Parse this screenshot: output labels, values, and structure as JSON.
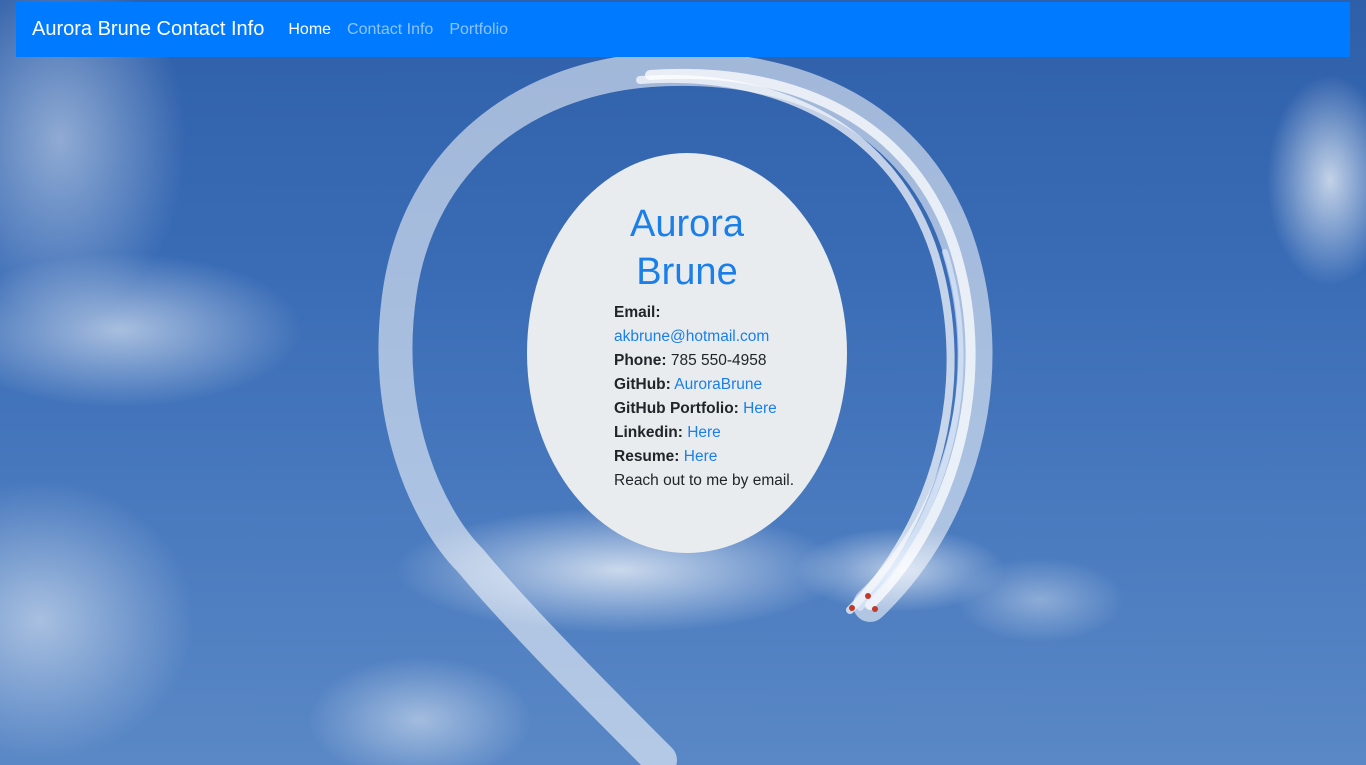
{
  "navbar": {
    "brand": "Aurora Brune Contact Info",
    "links": [
      {
        "label": "Home",
        "active": true
      },
      {
        "label": "Contact Info",
        "active": false
      },
      {
        "label": "Portfolio",
        "active": false
      }
    ]
  },
  "card": {
    "name_line1": "Aurora",
    "name_line2": "Brune",
    "email_label": "Email:",
    "email_value": "akbrune@hotmail.com",
    "phone_label": "Phone:",
    "phone_value": "785 550-4958",
    "github_label": "GitHub:",
    "github_value": "AuroraBrune",
    "github_portfolio_label": "GitHub Portfolio:",
    "github_portfolio_value": "Here",
    "linkedin_label": "Linkedin:",
    "linkedin_value": "Here",
    "resume_label": "Resume:",
    "resume_value": "Here",
    "note": "Reach out to me by email."
  },
  "colors": {
    "navbar": "#007bff",
    "link": "#1a7fe8",
    "card": "#e9ecef"
  }
}
